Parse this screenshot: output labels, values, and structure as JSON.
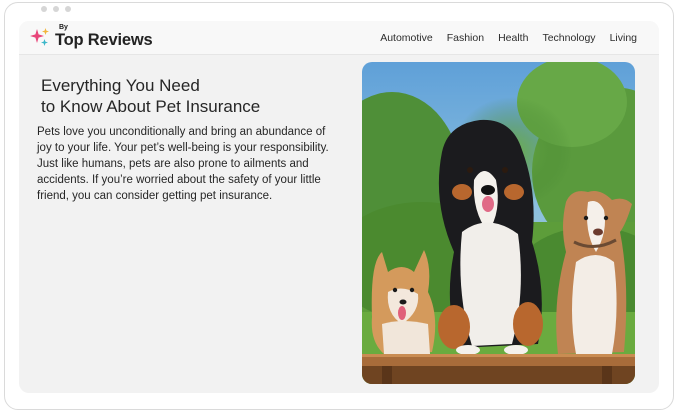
{
  "site": {
    "logo_by": "By",
    "logo_name": "Top Reviews"
  },
  "nav": {
    "items": [
      {
        "label": "Automotive"
      },
      {
        "label": "Fashion"
      },
      {
        "label": "Health"
      },
      {
        "label": "Technology"
      },
      {
        "label": "Living"
      }
    ]
  },
  "article": {
    "title_line1": "Everything You Need",
    "title_line2": "to Know About Pet Insurance",
    "body": "Pets love you unconditionally and bring an abundance of joy to your life. Your pet’s well-being is your responsibility. Just like humans, pets are also prone to ailments and accidents. If you’re worried about the safety of your little friend, you can consider getting pet insurance."
  },
  "colors": {
    "logo_spark_pink": "#e8457a",
    "logo_spark_gold": "#f2b53c",
    "logo_spark_teal": "#3cb7c9",
    "page_background": "#f2f2f2"
  }
}
